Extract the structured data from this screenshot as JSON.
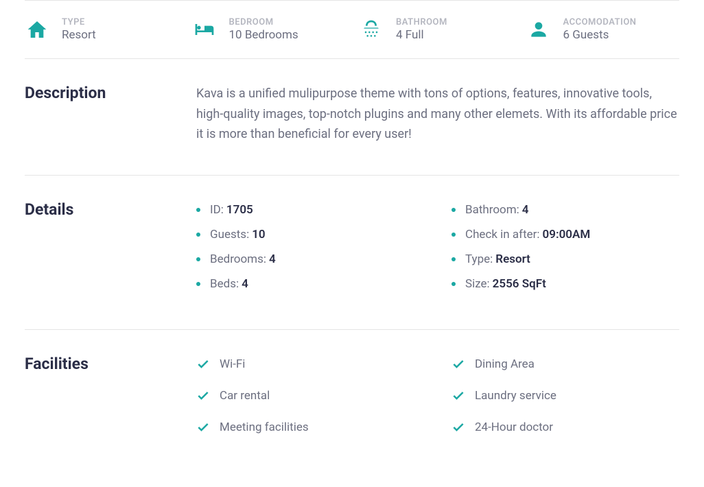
{
  "stats": [
    {
      "icon": "home",
      "label": "TYPE",
      "value": "Resort"
    },
    {
      "icon": "bed",
      "label": "BEDROOM",
      "value": "10 Bedrooms"
    },
    {
      "icon": "shower",
      "label": "BATHROOM",
      "value": "4 Full"
    },
    {
      "icon": "person",
      "label": "ACCOMODATION",
      "value": "6 Guests"
    }
  ],
  "description": {
    "title": "Description",
    "text": "Kava is a unified mulipurpose theme with tons of options, features, innovative tools, high-quality images, top-notch plugins and many other elemets. With its affordable price it is more than beneficial for every user!"
  },
  "details": {
    "title": "Details",
    "col1": [
      {
        "key": "ID:",
        "val": "1705"
      },
      {
        "key": "Guests:",
        "val": "10"
      },
      {
        "key": "Bedrooms:",
        "val": "4"
      },
      {
        "key": "Beds:",
        "val": "4"
      }
    ],
    "col2": [
      {
        "key": "Bathroom:",
        "val": "4"
      },
      {
        "key": "Check in after:",
        "val": "09:00AM"
      },
      {
        "key": "Type:",
        "val": "Resort"
      },
      {
        "key": "Size:",
        "val": "2556 SqFt"
      }
    ]
  },
  "facilities": {
    "title": "Facilities",
    "col1": [
      "Wi-Fi",
      "Car rental",
      "Meeting facilities"
    ],
    "col2": [
      "Dining Area",
      "Laundry service",
      "24-Hour doctor"
    ]
  }
}
